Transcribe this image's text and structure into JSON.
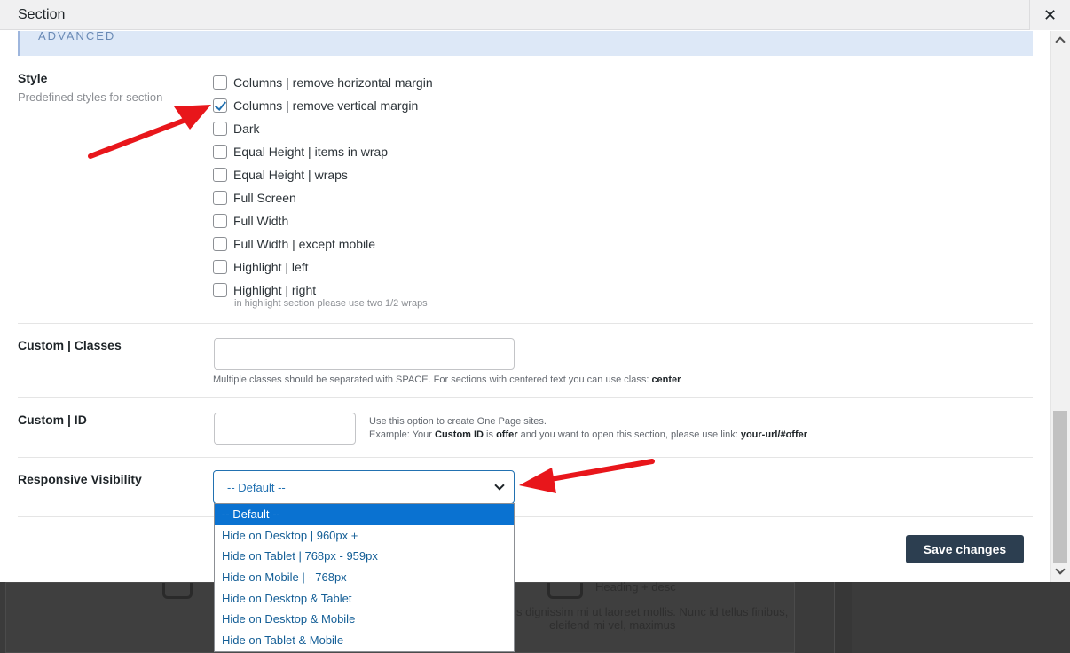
{
  "modal": {
    "title": "Section",
    "close_icon": "close-icon"
  },
  "section_header": "ADVANCED",
  "style": {
    "label": "Style",
    "sublabel": "Predefined styles for section",
    "options": [
      {
        "label": "Columns | remove horizontal margin",
        "checked": false
      },
      {
        "label": "Columns | remove vertical margin",
        "checked": true
      },
      {
        "label": "Dark",
        "checked": false
      },
      {
        "label": "Equal Height | items in wrap",
        "checked": false
      },
      {
        "label": "Equal Height | wraps",
        "checked": false
      },
      {
        "label": "Full Screen",
        "checked": false
      },
      {
        "label": "Full Width",
        "checked": false
      },
      {
        "label": "Full Width | except mobile",
        "checked": false
      },
      {
        "label": "Highlight | left",
        "checked": false
      },
      {
        "label": "Highlight | right",
        "checked": false
      }
    ],
    "note": "in highlight section please use two 1/2 wraps"
  },
  "custom_classes": {
    "label": "Custom | Classes",
    "value": "",
    "help_prefix": "Multiple classes should be separated with SPACE. For sections with centered text you can use class: ",
    "help_bold": "center"
  },
  "custom_id": {
    "label": "Custom | ID",
    "value": "",
    "help_line1": "Use this option to create One Page sites.",
    "help_line2_a": "Example: Your ",
    "help_line2_b": "Custom ID",
    "help_line2_c": " is ",
    "help_line2_d": "offer",
    "help_line2_e": " and you want to open this section, please use link: ",
    "help_line2_f": "your-url/#offer"
  },
  "responsive": {
    "label": "Responsive Visibility",
    "selected": "-- Default --",
    "options": [
      "-- Default --",
      "Hide on Desktop | 960px +",
      "Hide on Tablet | 768px - 959px",
      "Hide on Mobile | - 768px",
      "Hide on Desktop & Tablet",
      "Hide on Desktop & Mobile",
      "Hide on Tablet & Mobile"
    ]
  },
  "save_label": "Save changes",
  "background": {
    "heading_desc": "Heading + desc",
    "lorem1": "s dignissim mi ut laoreet mollis. Nunc id tellus finibus,",
    "lorem2": "eleifend mi vel, maximus"
  },
  "colors": {
    "accent": "#2271b1",
    "selected_option": "#0a72d1",
    "save_button": "#2c3e50",
    "annotation_arrow": "#e8161b"
  }
}
